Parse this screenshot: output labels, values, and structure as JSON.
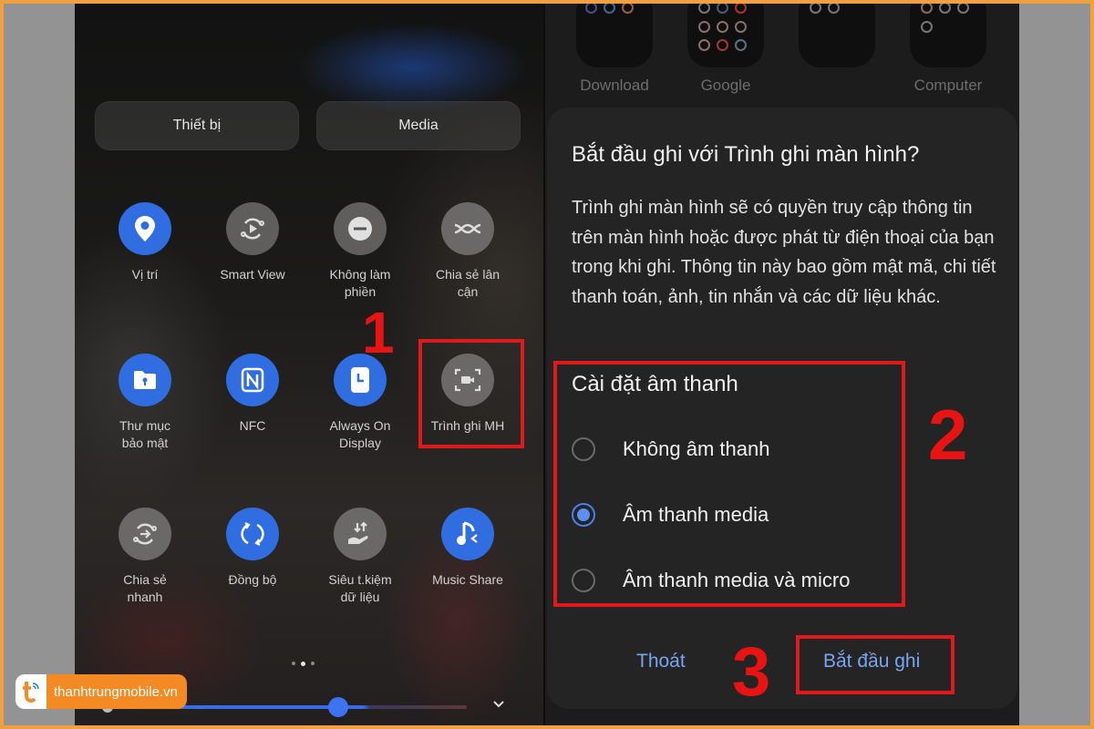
{
  "left_phone": {
    "segments": [
      {
        "label": "Thiết bị"
      },
      {
        "label": "Media"
      }
    ],
    "tiles": [
      {
        "label": "Vị trí",
        "icon": "location-pin-icon",
        "state": "on"
      },
      {
        "label": "Smart View",
        "icon": "smart-view-icon",
        "state": "off"
      },
      {
        "label": "Không làm phiền",
        "icon": "do-not-disturb-icon",
        "state": "off"
      },
      {
        "label": "Chia sẻ lân cận",
        "icon": "nearby-share-icon",
        "state": "off"
      },
      {
        "label": "Thư mục bảo mật",
        "icon": "secure-folder-icon",
        "state": "on"
      },
      {
        "label": "NFC",
        "icon": "nfc-icon",
        "state": "on"
      },
      {
        "label": "Always On Display",
        "icon": "always-on-display-icon",
        "state": "on"
      },
      {
        "label": "Trình ghi MH",
        "icon": "screen-recorder-icon",
        "state": "off"
      },
      {
        "label": "Chia sẻ nhanh",
        "icon": "quick-share-icon",
        "state": "off"
      },
      {
        "label": "Đồng bộ",
        "icon": "sync-icon",
        "state": "on"
      },
      {
        "label": "Siêu t.kiệm dữ liệu",
        "icon": "data-saver-icon",
        "state": "off"
      },
      {
        "label": "Music Share",
        "icon": "music-share-icon",
        "state": "on"
      }
    ],
    "page_indicator": {
      "pages": 3,
      "current": 2
    },
    "brightness_percent": 63
  },
  "right_phone": {
    "folders": [
      {
        "label": "Download"
      },
      {
        "label": "Google"
      },
      {
        "label": ""
      },
      {
        "label": "Computer"
      }
    ],
    "dialog": {
      "title": "Bắt đầu ghi với Trình ghi màn hình?",
      "body": "Trình ghi màn hình sẽ có quyền truy cập thông tin trên màn hình hoặc được phát từ điện thoại của bạn trong khi ghi. Thông tin này bao gồm mật mã, chi tiết thanh toán, ảnh, tin nhắn và các dữ liệu khác.",
      "sound_section_title": "Cài đặt âm thanh",
      "options": [
        {
          "label": "Không âm thanh",
          "selected": false
        },
        {
          "label": "Âm thanh media",
          "selected": true
        },
        {
          "label": "Âm thanh media và micro",
          "selected": false
        }
      ],
      "cancel_label": "Thoát",
      "start_label": "Bắt đầu ghi"
    }
  },
  "annotations": {
    "step1": "1",
    "step2": "2",
    "step3": "3",
    "color": "#e01a1a"
  },
  "watermark": {
    "text": "thanhtrungmobile.vn"
  },
  "colors": {
    "accent_blue": "#2f6de0",
    "frame_orange": "#f0a040",
    "button_text_blue": "#7aa5ee"
  }
}
